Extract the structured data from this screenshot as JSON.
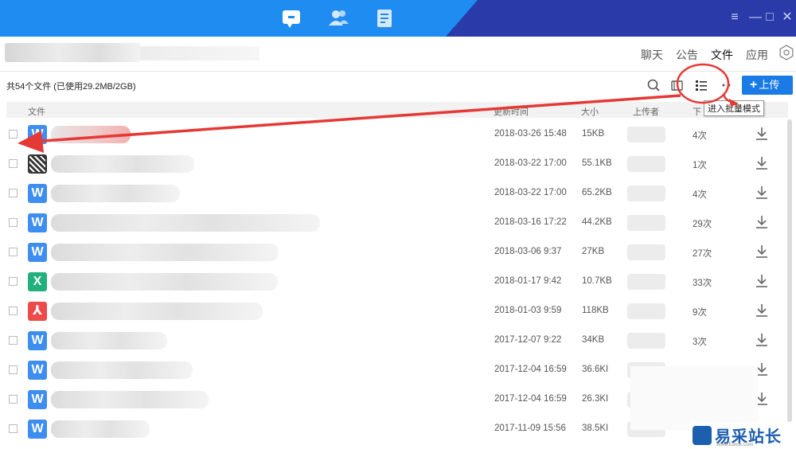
{
  "titlebar": {
    "nav_icons": [
      "chat-icon",
      "contacts-icon",
      "docs-icon"
    ],
    "window_controls": [
      "≡",
      "—",
      "□",
      "✕"
    ]
  },
  "tabs": [
    {
      "label": "聊天",
      "active": false
    },
    {
      "label": "公告",
      "active": false
    },
    {
      "label": "文件",
      "active": true
    },
    {
      "label": "应用",
      "active": false
    }
  ],
  "toolbar": {
    "info": "共54个文件 (已使用29.2MB/2GB)",
    "upload_label": "上传",
    "tooltip": "进入批量模式"
  },
  "table": {
    "headers": {
      "name": "文件",
      "time": "更新时间",
      "size": "大小",
      "uploader": "上传者",
      "count": "下"
    },
    "rows": [
      {
        "type": "w",
        "icon_label": "W",
        "time": "2018-03-26 15:48",
        "size": "15KB",
        "count": "4次",
        "blur_w": 100
      },
      {
        "type": "qr",
        "icon_label": "",
        "time": "2018-03-22 17:00",
        "size": "55.1KB",
        "count": "1次",
        "blur_w": 180
      },
      {
        "type": "w",
        "icon_label": "W",
        "time": "2018-03-22 17:00",
        "size": "65.2KB",
        "count": "4次",
        "blur_w": 162
      },
      {
        "type": "w",
        "icon_label": "W",
        "time": "2018-03-16 17:22",
        "size": "44.2KB",
        "count": "29次",
        "blur_w": 338
      },
      {
        "type": "w",
        "icon_label": "W",
        "time": "2018-03-06 9:37",
        "size": "27KB",
        "count": "27次",
        "blur_w": 286
      },
      {
        "type": "x",
        "icon_label": "X",
        "time": "2018-01-17 9:42",
        "size": "10.7KB",
        "count": "33次",
        "blur_w": 285
      },
      {
        "type": "p",
        "icon_label": "⅄",
        "time": "2018-01-03 9:59",
        "size": "118KB",
        "count": "9次",
        "blur_w": 266
      },
      {
        "type": "w",
        "icon_label": "W",
        "time": "2017-12-07 9:22",
        "size": "34KB",
        "count": "3次",
        "blur_w": 146
      },
      {
        "type": "w",
        "icon_label": "W",
        "time": "2017-12-04 16:59",
        "size": "36.6KI",
        "count": "",
        "blur_w": 178
      },
      {
        "type": "w",
        "icon_label": "W",
        "time": "2017-12-04 16:59",
        "size": "26.3KI",
        "count": "",
        "blur_w": 198
      },
      {
        "type": "w",
        "icon_label": "W",
        "time": "2017-11-09 15:56",
        "size": "38.5KI",
        "count": "",
        "blur_w": 124
      }
    ]
  },
  "watermark": {
    "text": "易采站长站",
    "sub": "Www.Easck.Com"
  },
  "colors": {
    "titlebar": "#1e8cf0",
    "titlebar_dark": "#2a3aa8",
    "accent": "#1a7be6",
    "annotation": "#e53935"
  }
}
